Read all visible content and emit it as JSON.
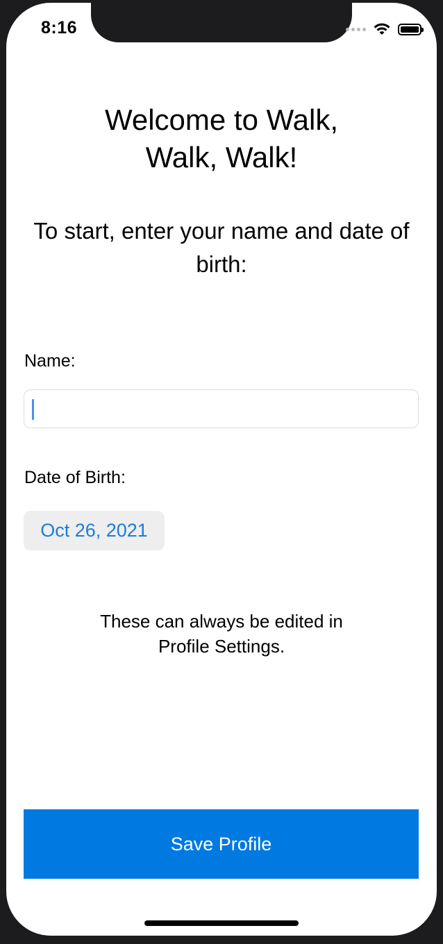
{
  "status_bar": {
    "time": "8:16",
    "icons": [
      "signal-dots-icon",
      "wifi-icon",
      "battery-icon"
    ]
  },
  "welcome": {
    "title_line1": "Welcome to Walk,",
    "title_line2": "Walk, Walk!"
  },
  "instruction": {
    "text": "To start, enter your name and date of birth:"
  },
  "form": {
    "name_label": "Name:",
    "name_value": "",
    "dob_label": "Date of Birth:",
    "dob_value": "Oct 26, 2021"
  },
  "note": {
    "line1": "These can always be edited in",
    "line2": "Profile Settings."
  },
  "actions": {
    "save_label": "Save Profile"
  },
  "colors": {
    "accent": "#0079e0",
    "date_text": "#1d7bdb",
    "cursor": "#4a8df0"
  }
}
